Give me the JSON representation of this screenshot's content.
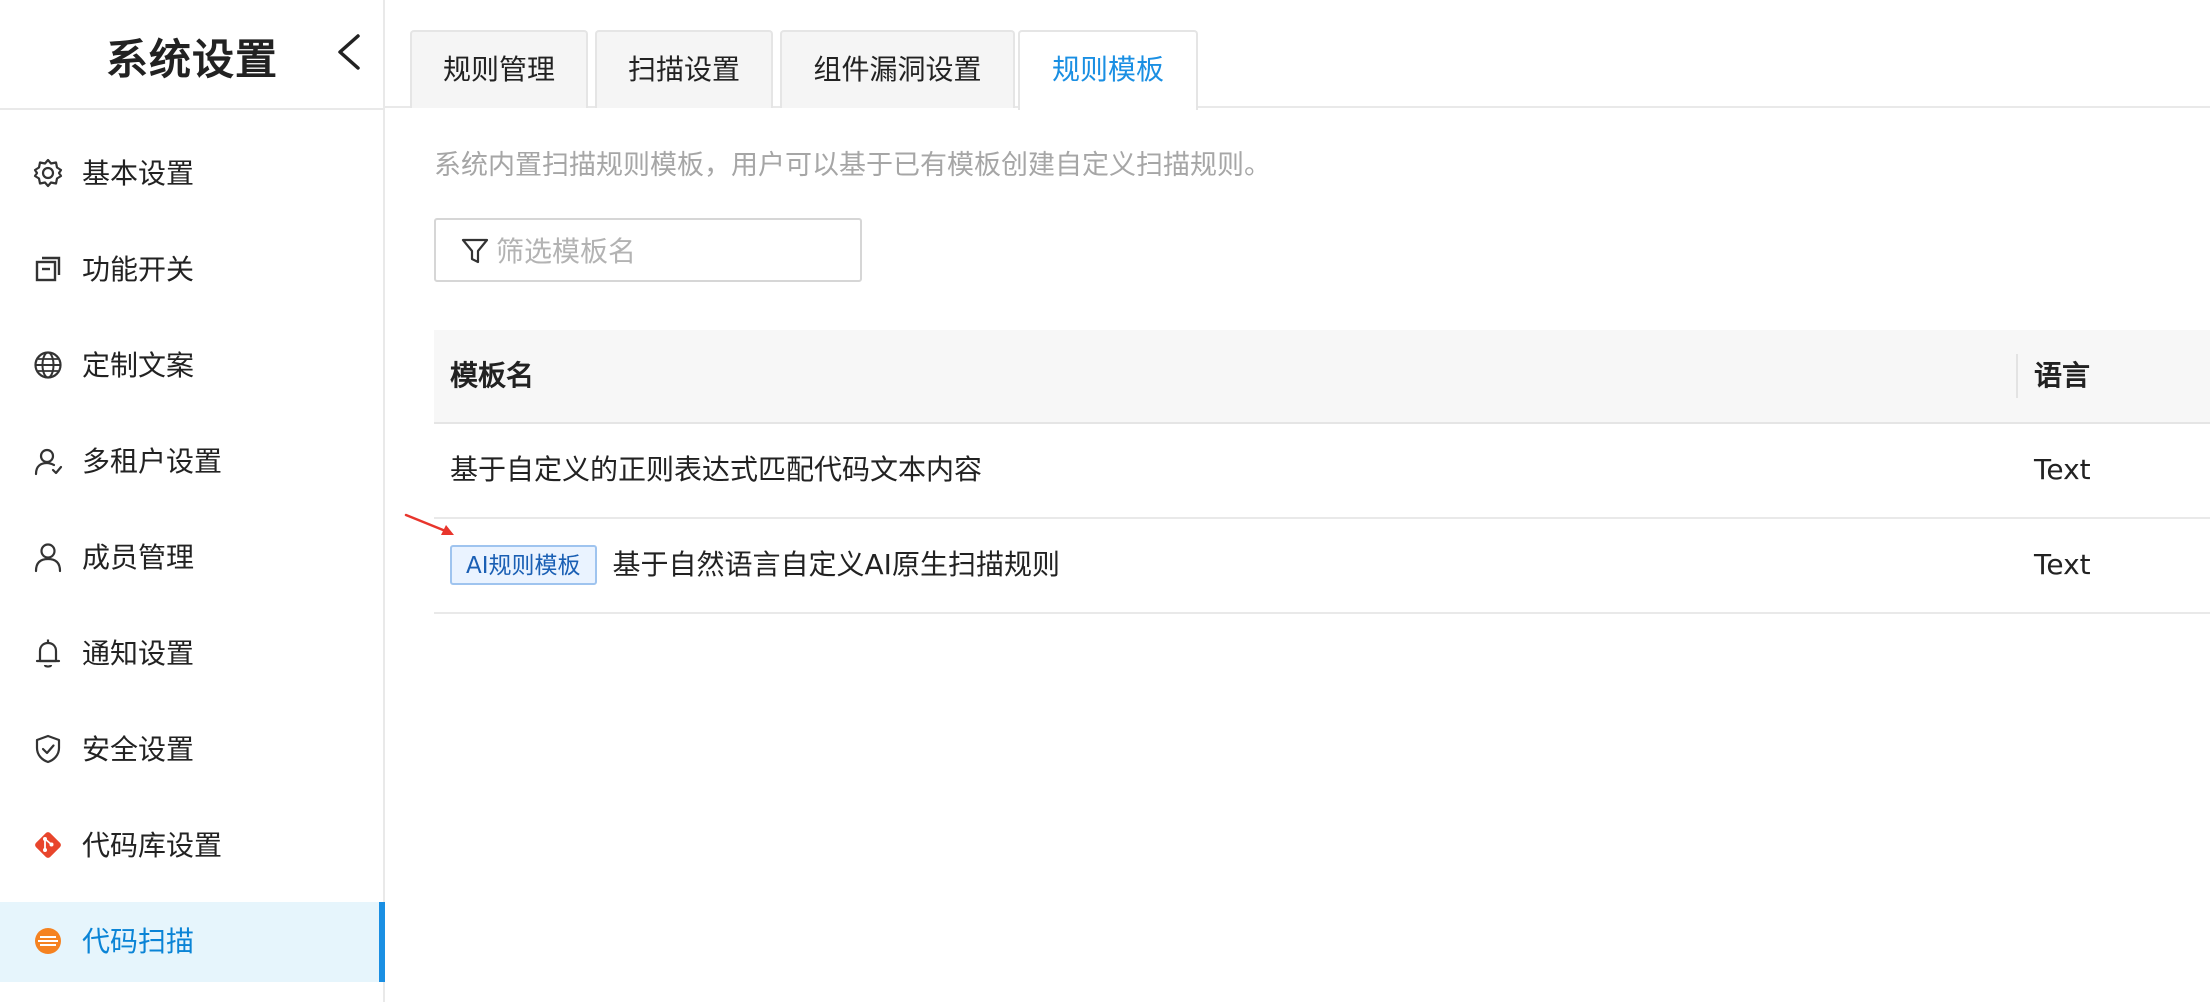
{
  "sidebar": {
    "title": "系统设置",
    "items": [
      {
        "label": "基本设置",
        "icon": "gear-icon"
      },
      {
        "label": "功能开关",
        "icon": "toggle-window-icon"
      },
      {
        "label": "定制文案",
        "icon": "globe-icon"
      },
      {
        "label": "多租户设置",
        "icon": "multi-user-icon"
      },
      {
        "label": "成员管理",
        "icon": "user-icon"
      },
      {
        "label": "通知设置",
        "icon": "bell-icon"
      },
      {
        "label": "安全设置",
        "icon": "shield-check-icon"
      },
      {
        "label": "代码库设置",
        "icon": "git-icon"
      },
      {
        "label": "代码扫描",
        "icon": "scan-icon",
        "active": true
      }
    ]
  },
  "tabs": [
    {
      "label": "规则管理"
    },
    {
      "label": "扫描设置"
    },
    {
      "label": "组件漏洞设置"
    },
    {
      "label": "规则模板",
      "active": true
    }
  ],
  "main": {
    "description": "系统内置扫描规则模板，用户可以基于已有模板创建自定义扫描规则。",
    "filter_placeholder": "筛选模板名",
    "table": {
      "columns": [
        "模板名",
        "语言"
      ],
      "rows": [
        {
          "tag": "",
          "name": "基于自定义的正则表达式匹配代码文本内容",
          "language": "Text"
        },
        {
          "tag": "AI规则模板",
          "name": "基于自然语言自定义AI原生扫描规则",
          "language": "Text"
        }
      ]
    }
  },
  "colors": {
    "accent": "#1a8fe3",
    "active_bg": "#e6f5fc",
    "git_icon": "#e8452c",
    "scan_icon": "#f58220",
    "annotation_arrow": "#e8352c"
  }
}
